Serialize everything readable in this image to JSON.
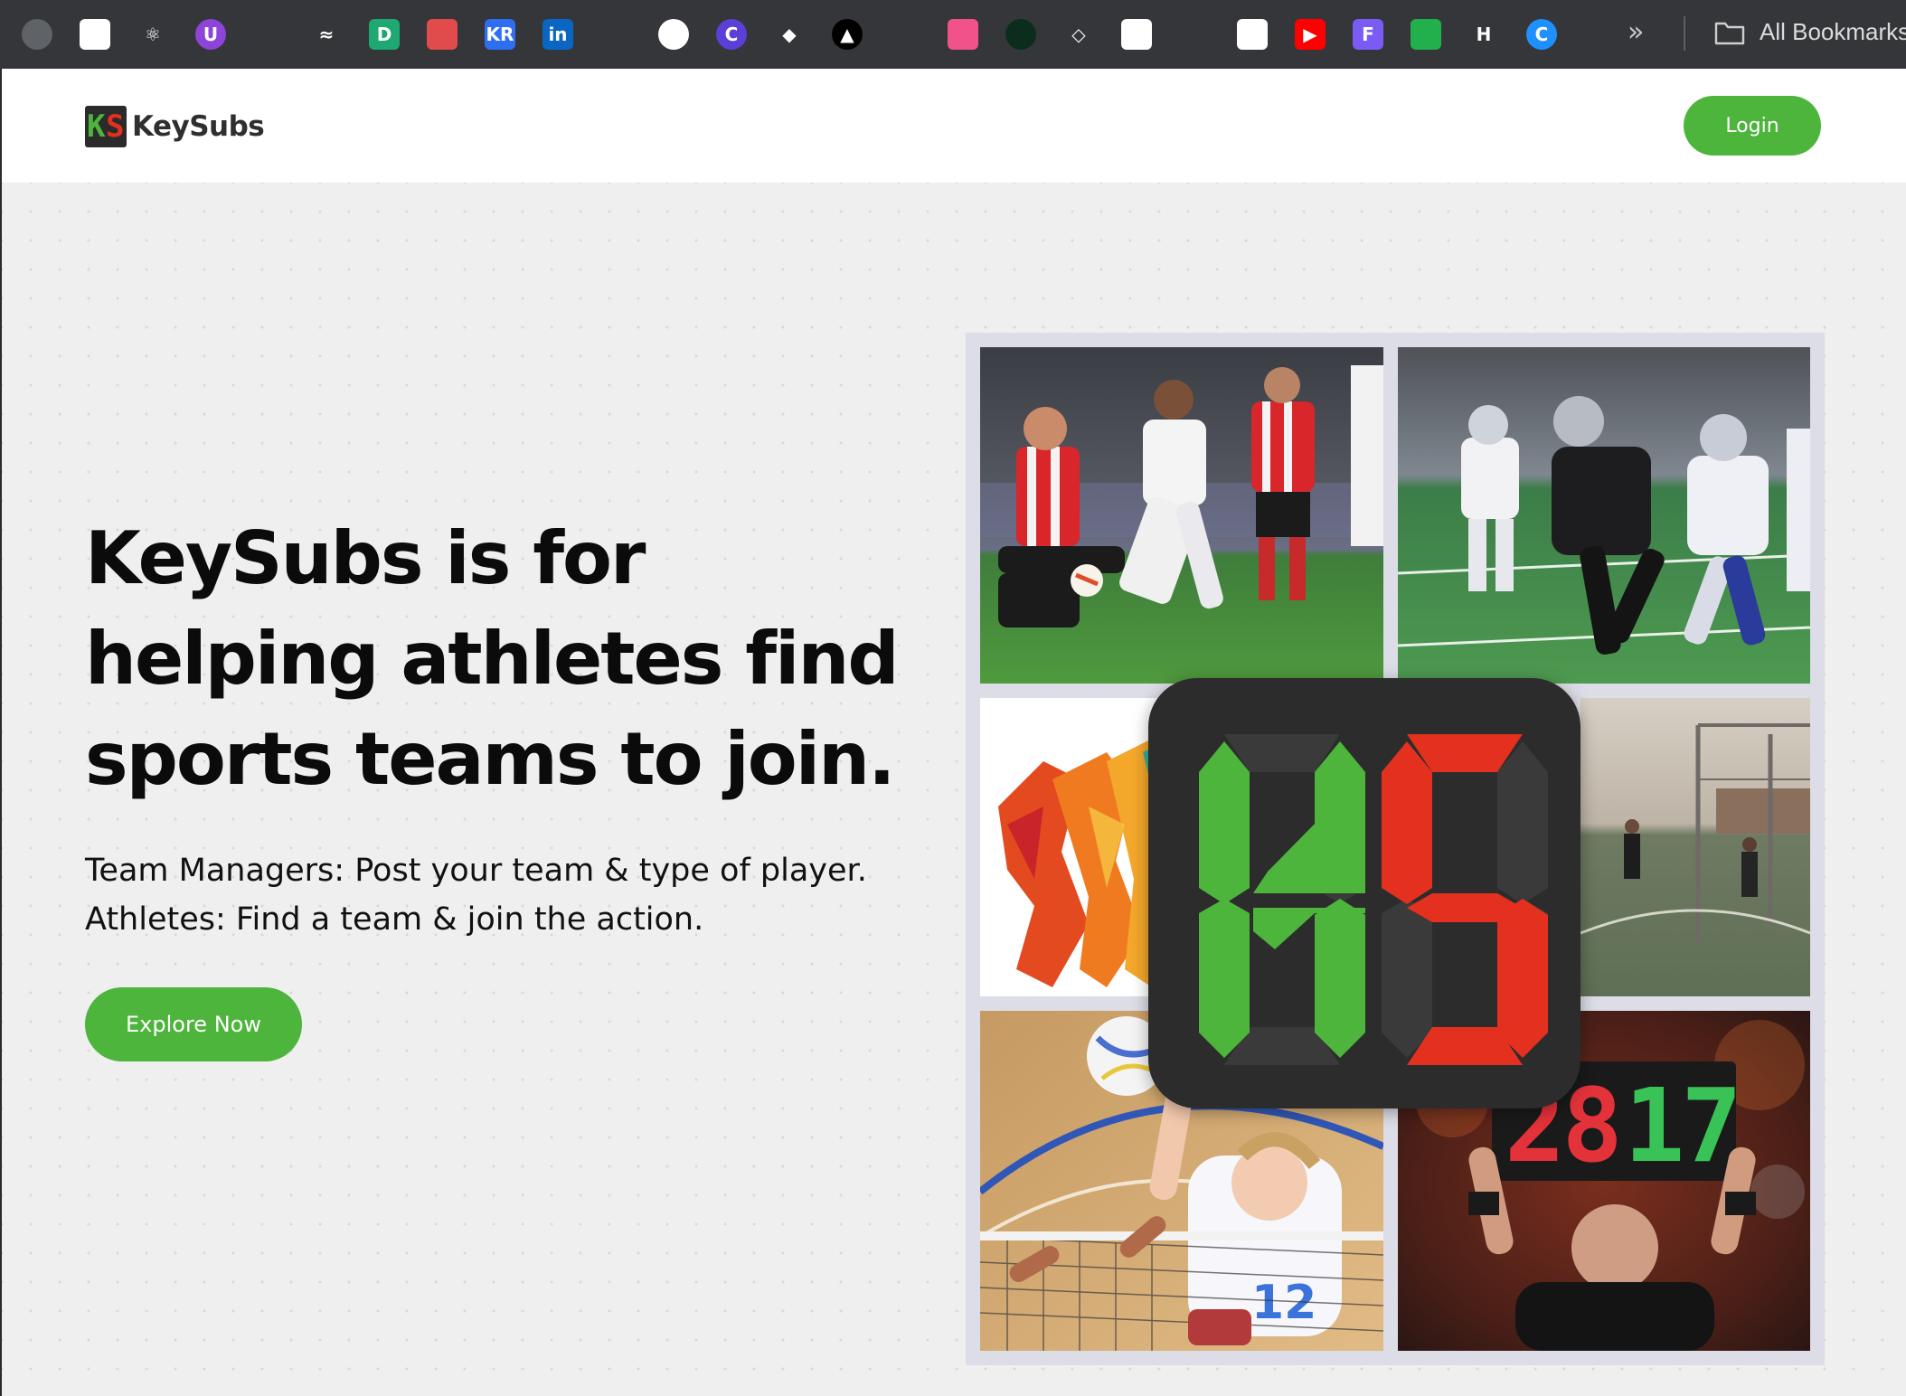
{
  "browser": {
    "bookmarks": [
      {
        "icon": "globe-icon",
        "glyph": "",
        "bg": "#5f6368",
        "round": true
      },
      {
        "icon": "openai-icon",
        "glyph": "",
        "bg": "#ffffff",
        "round": false
      },
      {
        "icon": "react-icon",
        "glyph": "⚛",
        "bg": "#35363a",
        "round": true
      },
      {
        "icon": "u-app-icon",
        "glyph": "U",
        "bg": "#8e44d8",
        "round": true
      },
      {
        "icon": "github-icon",
        "glyph": "",
        "bg": "#35363a",
        "round": true
      },
      {
        "icon": "tailwind-icon",
        "glyph": "≈",
        "bg": "#35363a",
        "round": false
      },
      {
        "icon": "d-app-icon",
        "glyph": "D",
        "bg": "#1ea872",
        "round": false
      },
      {
        "icon": "openai-red-icon",
        "glyph": "",
        "bg": "#e14b4b",
        "round": false
      },
      {
        "icon": "kr-icon",
        "glyph": "KR",
        "bg": "#2e6ff2",
        "round": false
      },
      {
        "icon": "linkedin-icon",
        "glyph": "in",
        "bg": "#0a66c2",
        "round": false
      },
      {
        "icon": "google-drive-icon",
        "glyph": "",
        "bg": "#35363a",
        "round": false
      },
      {
        "icon": "circle-app-icon",
        "glyph": "",
        "bg": "#ffffff",
        "round": true
      },
      {
        "icon": "canva-icon",
        "glyph": "C",
        "bg": "#5b3fd6",
        "round": true
      },
      {
        "icon": "diamond-app-icon",
        "glyph": "◆",
        "bg": "#35363a",
        "round": false
      },
      {
        "icon": "triangle-app-icon",
        "glyph": "▲",
        "bg": "#000000",
        "round": true
      },
      {
        "icon": "github-alt-icon",
        "glyph": "",
        "bg": "#35363a",
        "round": true
      },
      {
        "icon": "pink-app-icon",
        "glyph": "",
        "bg": "#f2528a",
        "round": false
      },
      {
        "icon": "mongodb-icon",
        "glyph": "",
        "bg": "#0c2d1c",
        "round": true
      },
      {
        "icon": "gem-icon",
        "glyph": "◇",
        "bg": "#35363a",
        "round": false
      },
      {
        "icon": "doc-icon",
        "glyph": "",
        "bg": "#ffffff",
        "round": false
      },
      {
        "icon": "mixed-app-icon",
        "glyph": "",
        "bg": "#35363a",
        "round": false
      },
      {
        "icon": "tag-icon",
        "glyph": "",
        "bg": "#ffffff",
        "round": false
      },
      {
        "icon": "youtube-icon",
        "glyph": "▶",
        "bg": "#ff0000",
        "round": false
      },
      {
        "icon": "f-app-icon",
        "glyph": "F",
        "bg": "#7a5cf5",
        "round": false
      },
      {
        "icon": "green-app-icon",
        "glyph": "",
        "bg": "#21b04b",
        "round": false
      },
      {
        "icon": "h-app-icon",
        "glyph": "H",
        "bg": "#35363a",
        "round": false
      },
      {
        "icon": "c-circle-icon",
        "glyph": "C",
        "bg": "#1e90ff",
        "round": true
      }
    ],
    "all_bookmarks_label": "All Bookmarks"
  },
  "header": {
    "logo_text": "KeySubs",
    "login_label": "Login"
  },
  "hero": {
    "title": "KeySubs is for helping athletes find sports teams to join.",
    "subtitle_line1": "Team Managers: Post your team & type of player.",
    "subtitle_line2": "Athletes: Find a team & join the action.",
    "cta_label": "Explore Now"
  },
  "collage": {
    "images": [
      "soccer-photo",
      "american-football-photo",
      "colorful-athletes-silhouettes",
      "outdoor-court-photo",
      "volleyball-photo",
      "substitution-board-photo"
    ],
    "scoreboard_digits": "2817",
    "jersey_number": "12"
  },
  "colors": {
    "brand_green": "#4db43c",
    "brand_red": "#e3301f",
    "badge_dark": "#2c2c2c",
    "page_bg": "#efeff0"
  }
}
